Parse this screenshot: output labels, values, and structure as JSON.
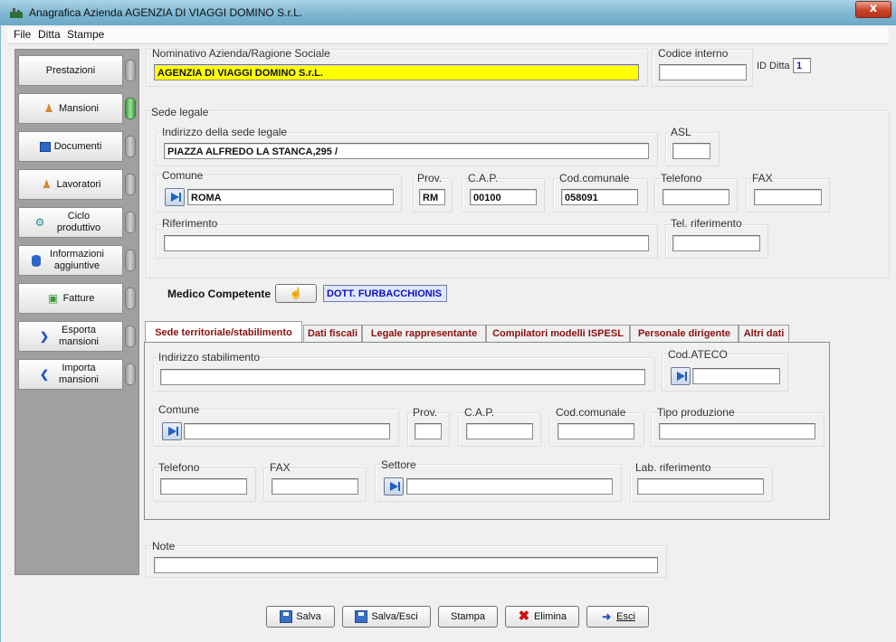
{
  "window": {
    "title": "Anagrafica Azienda AGENZIA DI VIAGGI DOMINO S.r.L.",
    "close_glyph": "x"
  },
  "menu": [
    "File",
    "Ditta",
    "Stampe"
  ],
  "nav": [
    {
      "label": "Prestazioni",
      "icon": "none",
      "led": "off"
    },
    {
      "label": "Mansioni",
      "icon": "worker-icon",
      "led": "on"
    },
    {
      "label": "Documenti",
      "icon": "document-icon",
      "led": "off"
    },
    {
      "label": "Lavoratori",
      "icon": "worker-icon",
      "led": "off"
    },
    {
      "label": "Ciclo produttivo",
      "icon": "gears-icon",
      "led": "off"
    },
    {
      "label": "Informazioni aggiuntive",
      "icon": "database-icon",
      "led": "off"
    },
    {
      "label": "Fatture",
      "icon": "money-icon",
      "led": "off"
    },
    {
      "label": "Esporta mansioni",
      "icon": "arrow-right-icon",
      "led": "off"
    },
    {
      "label": "Importa mansioni",
      "icon": "arrow-left-icon",
      "led": "off"
    }
  ],
  "azienda": {
    "ragione_label": "Nominativo Azienda/Ragione Sociale",
    "ragione_value": "AGENZIA DI VIAGGI DOMINO S.r.L.",
    "codice_label": "Codice interno",
    "codice_value": "",
    "id_label": "ID Ditta",
    "id_value": "1"
  },
  "sede_legale": {
    "title": "Sede legale",
    "indirizzo_label": "Indirizzo della sede legale",
    "indirizzo_value": "PIAZZA ALFREDO LA STANCA,295 /",
    "asl_label": "ASL",
    "asl_value": "",
    "comune_label": "Comune",
    "comune_value": "ROMA",
    "prov_label": "Prov.",
    "prov_value": "RM",
    "cap_label": "C.A.P.",
    "cap_value": "00100",
    "codcom_label": "Cod.comunale",
    "codcom_value": "058091",
    "telefono_label": "Telefono",
    "telefono_value": "",
    "fax_label": "FAX",
    "fax_value": "",
    "rif_label": "Riferimento",
    "rif_value": "",
    "telrif_label": "Tel. riferimento",
    "telrif_value": ""
  },
  "medico": {
    "label": "Medico Competente",
    "value": "DOTT. FURBACCHIONIS"
  },
  "tabs": [
    "Sede territoriale/stabilimento",
    "Dati fiscali",
    "Legale rappresentante",
    "Compilatori modelli ISPESL",
    "Personale dirigente",
    "Altri dati"
  ],
  "stabilimento": {
    "indirizzo_label": "Indirizzo stabilimento",
    "ateco_label": "Cod.ATECO",
    "comune_label": "Comune",
    "prov_label": "Prov.",
    "cap_label": "C.A.P.",
    "codcom_label": "Cod.comunale",
    "tipo_label": "Tipo produzione",
    "telefono_label": "Telefono",
    "fax_label": "FAX",
    "settore_label": "Settore",
    "labrif_label": "Lab. riferimento"
  },
  "note_label": "Note",
  "buttons": [
    "Salva",
    "Salva/Esci",
    "Stampa",
    "Elimina",
    "Esci"
  ],
  "colors": {
    "highlight_field": "#ffff00",
    "tab_text": "#8b1010",
    "medico_text": "#1010c0"
  }
}
